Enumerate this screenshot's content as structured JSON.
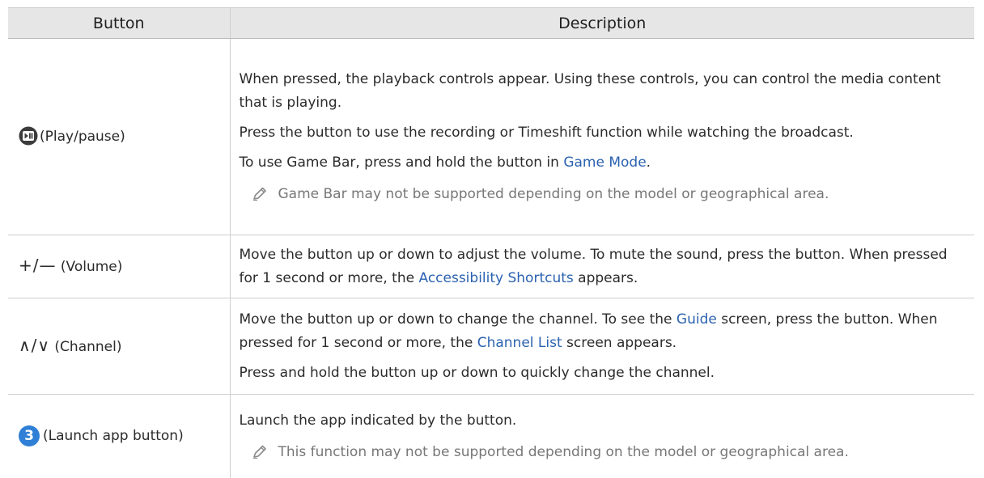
{
  "headers": {
    "button": "Button",
    "description": "Description"
  },
  "rows": [
    {
      "button_label": "(Play/pause)",
      "lines": [
        "When pressed, the playback controls appear. Using these controls, you can control the media content that is playing.",
        "Press the button to use the recording or Timeshift function while watching the broadcast."
      ],
      "game_line_before": "To use Game Bar, press and hold the button in ",
      "game_link": "Game Mode",
      "game_line_after": ".",
      "note": "Game Bar may not be supported depending on the model or geographical area."
    },
    {
      "button_symbol": "+/—",
      "button_label": "(Volume)",
      "text_before": "Move the button up or down to adjust the volume. To mute the sound, press the button. When pressed for 1 second or more, the ",
      "link": "Accessibility Shortcuts",
      "text_after": " appears."
    },
    {
      "button_symbol": "∧/∨",
      "button_label": "(Channel)",
      "text_before": "Move the button up or down to change the channel. To see the ",
      "link1": "Guide",
      "text_middle": " screen, press the button. When pressed for 1 second or more, the ",
      "link2": "Channel List",
      "text_after": " screen appears.",
      "line2": "Press and hold the button up or down to quickly change the channel."
    },
    {
      "button_icon_text": "3",
      "button_label": "(Launch app button)",
      "line1": "Launch the app indicated by the button.",
      "note": "This function may not be supported depending on the model or geographical area."
    }
  ],
  "colors": {
    "link": "#2b62b0",
    "header_bg": "#e6e6e6",
    "note_text": "#777777",
    "launch_icon": "#2f7fd6"
  },
  "icons": {
    "play_pause": "play-pause-icon",
    "note": "pencil-icon",
    "launch": "number-3-icon"
  }
}
